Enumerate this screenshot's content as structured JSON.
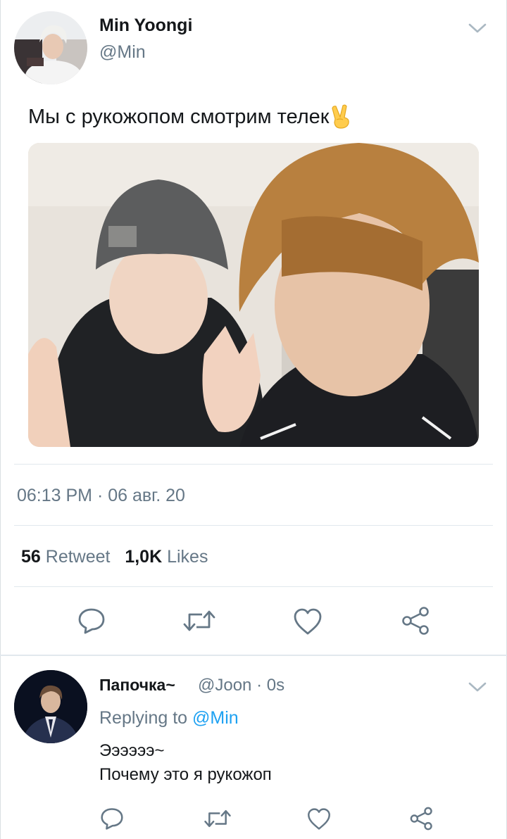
{
  "tweet": {
    "author_name": "Min Yoongi",
    "author_handle": "@Min",
    "text": "Мы с рукожопом смотрим телек",
    "emoji": "victory-hand-emoji",
    "timestamp": "06:13 PM · 06 авг. 20",
    "stats": {
      "retweets_count": "56",
      "retweets_label": "Retweet",
      "likes_count": "1,0K",
      "likes_label": "Likes"
    }
  },
  "actions": [
    "reply-icon",
    "retweet-icon",
    "like-icon",
    "share-icon"
  ],
  "reply": {
    "author_name": "Папочка~",
    "author_handle": "@Joon",
    "separator": "·",
    "time": "0s",
    "replying_prefix": "Replying to",
    "replying_to": "@Min",
    "text_line1": "Ээээээ~",
    "text_line2": "Почему это я рукожоп"
  },
  "colors": {
    "text": "#14171a",
    "secondary": "#657786",
    "accent": "#1da1f2",
    "divider": "#e1e8ed"
  }
}
